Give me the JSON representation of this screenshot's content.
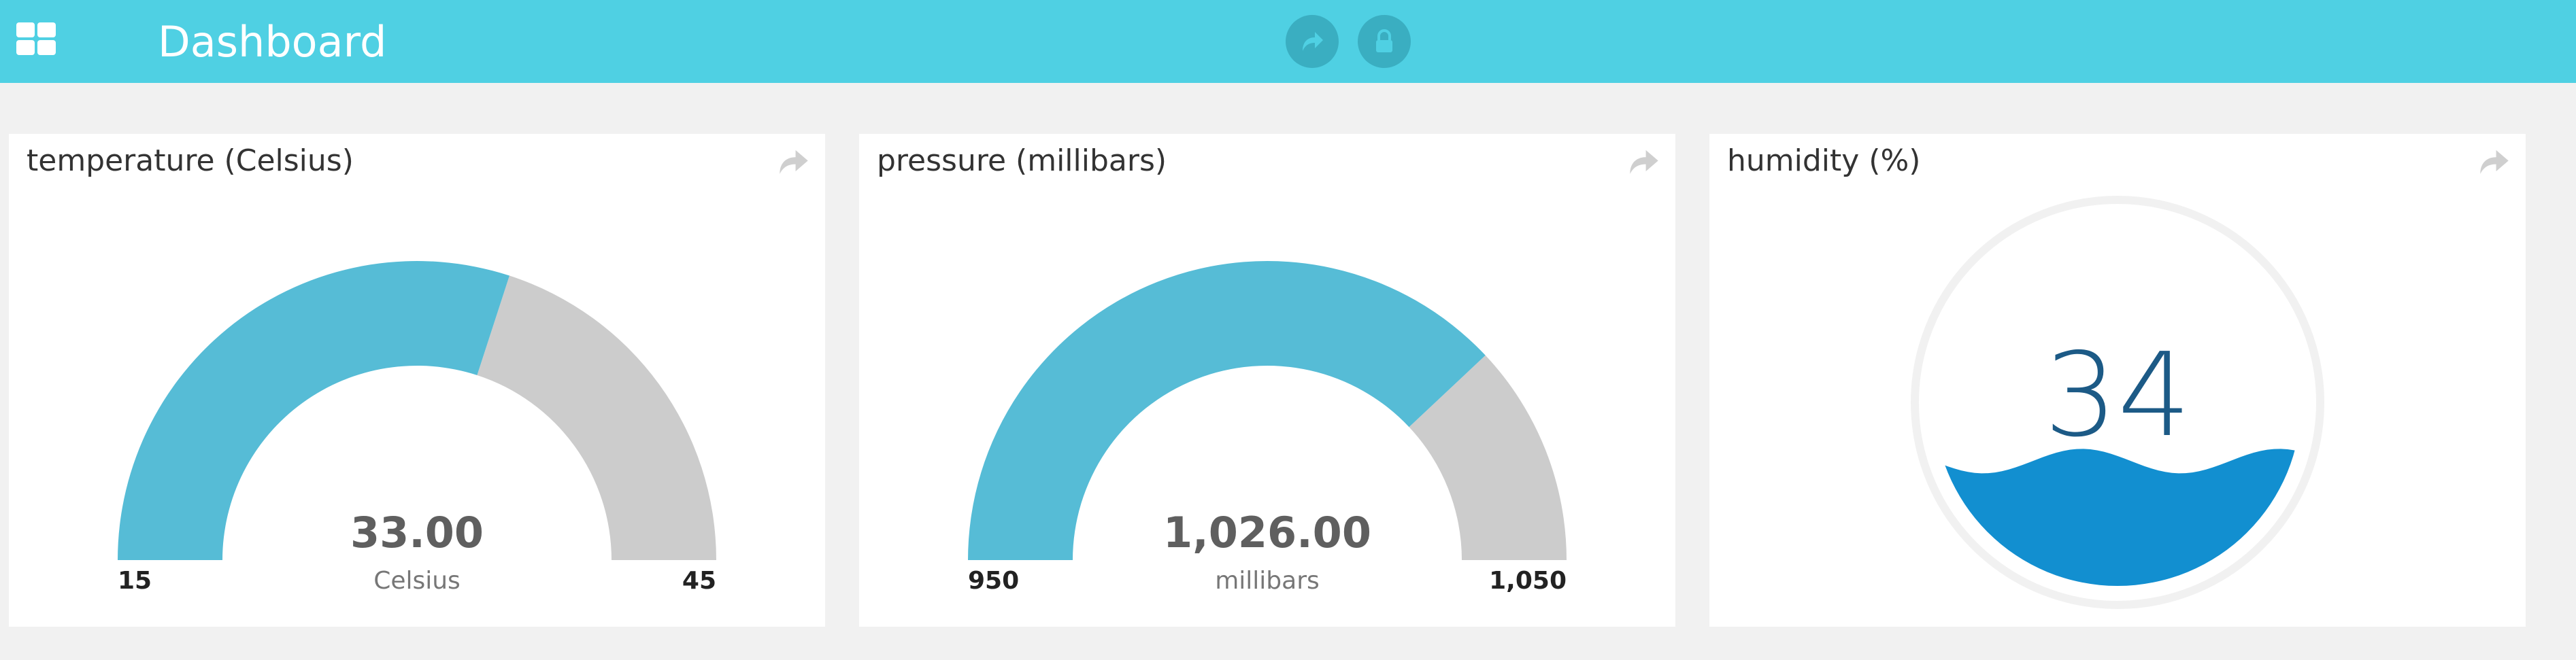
{
  "header": {
    "title": "Dashboard",
    "share_icon": "share-icon",
    "lock_icon": "lock-icon",
    "menu_icon": "grid-menu-icon"
  },
  "colors": {
    "header_bg": "#4fd0e3",
    "gauge_fill": "#56bcd6",
    "gauge_track": "#cccccc",
    "water": "#128fd0",
    "humidity_text": "#1c5a86"
  },
  "panels": [
    {
      "title": "temperature (Celsius)",
      "type": "gauge",
      "value": 33,
      "value_text": "33.00",
      "unit": "Celsius",
      "min": 15,
      "max": 45,
      "min_text": "15",
      "max_text": "45"
    },
    {
      "title": "pressure (millibars)",
      "type": "gauge",
      "value": 1026,
      "value_text": "1,026.00",
      "unit": "millibars",
      "min": 950,
      "max": 1050,
      "min_text": "950",
      "max_text": "1,050"
    },
    {
      "title": "humidity (%)",
      "type": "liquid-fill",
      "value": 34,
      "value_text": "34"
    }
  ]
}
